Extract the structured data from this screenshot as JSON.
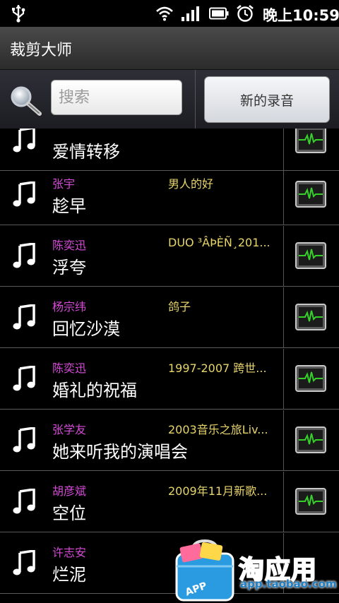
{
  "status_bar": {
    "time": "晚上10:59",
    "icons": [
      "usb-icon",
      "wifi-icon",
      "signal-icon",
      "battery-icon",
      "alarm-icon"
    ]
  },
  "app": {
    "title": "裁剪大师"
  },
  "search": {
    "placeholder": "搜索",
    "value": ""
  },
  "new_recording_label": "新的录音",
  "songs": [
    {
      "artist": "",
      "album": "",
      "title": "爱情转移"
    },
    {
      "artist": "张宇",
      "album": "男人的好",
      "title": "趁早"
    },
    {
      "artist": "陈奕迅",
      "album": "DUO ³ÂÞÈÑ¸201...",
      "title": "浮夸"
    },
    {
      "artist": "杨宗纬",
      "album": "鸽子",
      "title": "回忆沙漠"
    },
    {
      "artist": "陈奕迅",
      "album": "1997-2007 跨世...",
      "title": "婚礼的祝福"
    },
    {
      "artist": "张学友",
      "album": "2003音乐之旅Liv...",
      "title": "她来听我的演唱会"
    },
    {
      "artist": "胡彦斌",
      "album": "2009年11月新歌...",
      "title": "空位"
    },
    {
      "artist": "许志安",
      "album": "",
      "title": "烂泥"
    }
  ],
  "watermark": {
    "title": "淘应用",
    "url": "app.taobao.com",
    "badge": "APP"
  },
  "colors": {
    "artist": "#d64ad8",
    "album": "#e8d56a",
    "watermark": "#2a8fd6"
  }
}
